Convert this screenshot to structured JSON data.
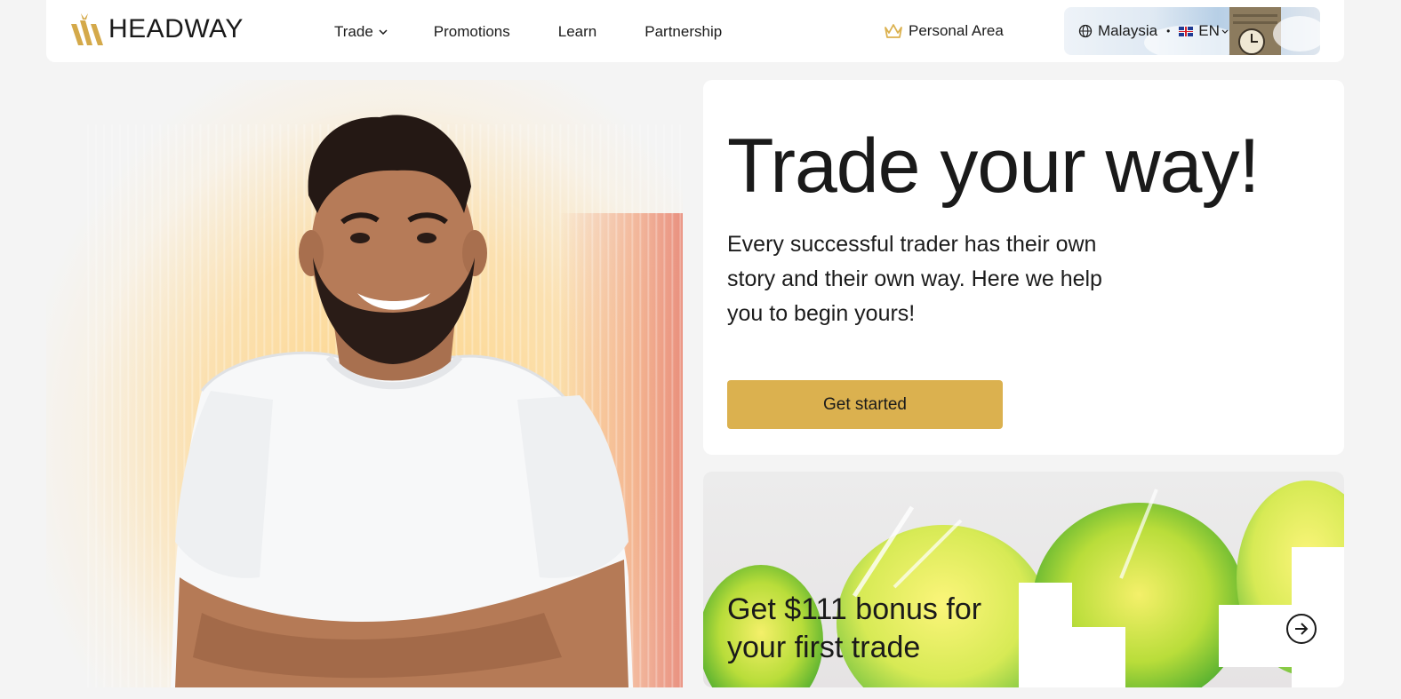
{
  "header": {
    "logo_text": "HEADWAY",
    "nav": [
      {
        "label": "Trade",
        "has_dropdown": true
      },
      {
        "label": "Promotions"
      },
      {
        "label": "Learn"
      },
      {
        "label": "Partnership"
      }
    ],
    "personal_area": "Personal Area",
    "locale": {
      "country": "Malaysia",
      "separator": "•",
      "language": "EN"
    }
  },
  "hero": {
    "title": "Trade your way!",
    "subtitle": "Every successful trader has their own story and their own way. Here we help you to begin yours!",
    "cta_label": "Get started"
  },
  "promo": {
    "text_line1": "Get $111 bonus for",
    "text_line2": "your first trade"
  },
  "colors": {
    "accent": "#dbb14f",
    "background": "#f4f4f4",
    "card": "#ffffff",
    "text": "#1c1c1c"
  },
  "icons": {
    "logo_mark": "crown-stripes-icon",
    "trade_chevron": "chevron-down-icon",
    "personal_area": "crown-icon",
    "globe": "globe-icon",
    "flag": "uk-flag-icon",
    "promo_arrow": "arrow-right-circle-icon"
  }
}
